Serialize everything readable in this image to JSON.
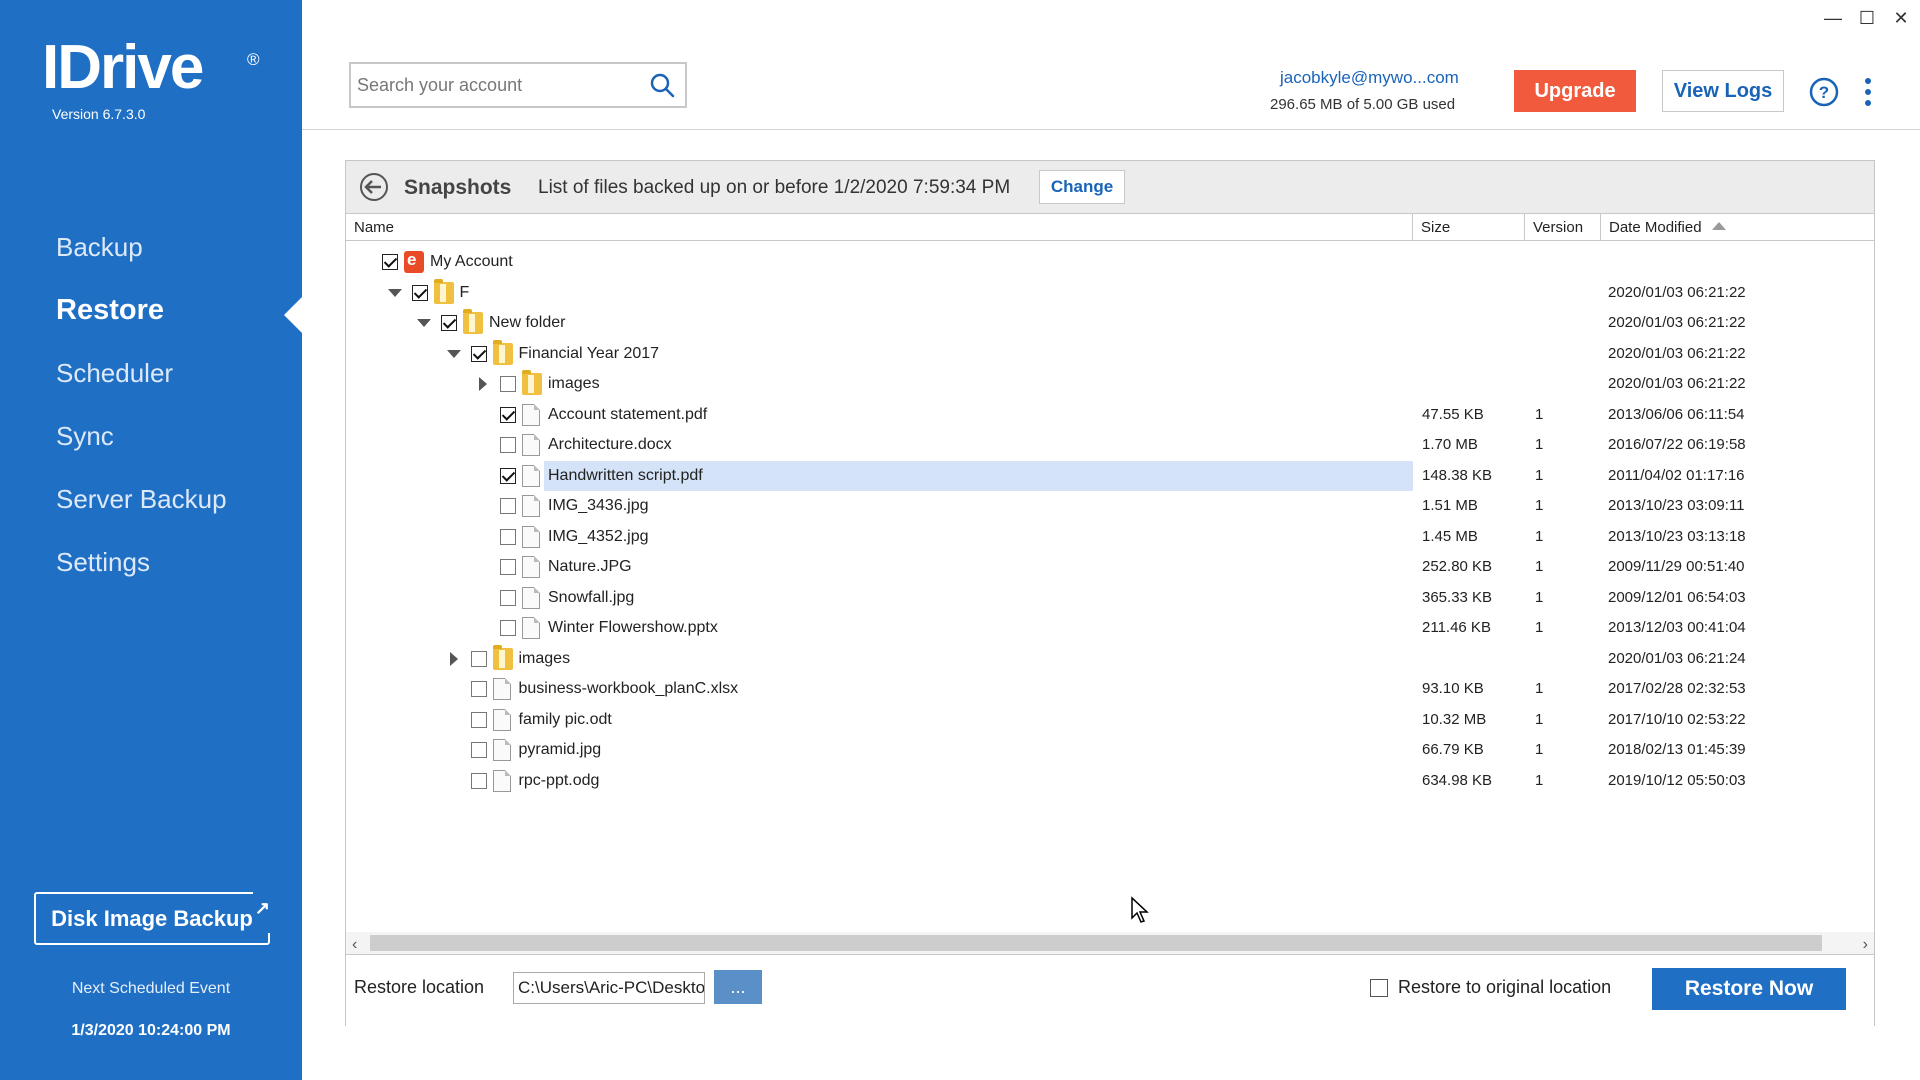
{
  "app": {
    "logo_text": "IDrive",
    "registered": "®",
    "version": "Version  6.7.3.0"
  },
  "sidebar": {
    "items": [
      {
        "label": "Backup"
      },
      {
        "label": "Restore"
      },
      {
        "label": "Scheduler"
      },
      {
        "label": "Sync"
      },
      {
        "label": "Server Backup"
      },
      {
        "label": "Settings"
      }
    ],
    "active": "Restore",
    "disk_image_label": "Disk Image Backup",
    "next_event_label": "Next Scheduled Event",
    "next_event_time": "1/3/2020 10:24:00 PM"
  },
  "window_controls": {
    "minimize": "—",
    "maximize": "☐",
    "close": "✕"
  },
  "header": {
    "search_placeholder": "Search your account",
    "email": "jacobkyle@mywo...com",
    "usage": "296.65 MB of 5.00 GB used",
    "upgrade_label": "Upgrade",
    "view_logs_label": "View Logs"
  },
  "snapshots": {
    "title": "Snapshots",
    "description": "List of files backed up on or before 1/2/2020 7:59:34 PM",
    "change_label": "Change"
  },
  "columns": {
    "name": "Name",
    "size": "Size",
    "version": "Version",
    "date": "Date Modified"
  },
  "tree": [
    {
      "name": "My Account",
      "type": "account",
      "depth": 0,
      "checked": true,
      "expand": "none",
      "size": "",
      "version": "",
      "date": ""
    },
    {
      "name": "F",
      "type": "folder",
      "depth": 1,
      "checked": true,
      "expand": "down",
      "size": "",
      "version": "",
      "date": "2020/01/03 06:21:22"
    },
    {
      "name": "New folder",
      "type": "folder",
      "depth": 2,
      "checked": true,
      "expand": "down",
      "size": "",
      "version": "",
      "date": "2020/01/03 06:21:22"
    },
    {
      "name": "Financial Year 2017",
      "type": "folder",
      "depth": 3,
      "checked": true,
      "expand": "down",
      "size": "",
      "version": "",
      "date": "2020/01/03 06:21:22"
    },
    {
      "name": "images",
      "type": "folder",
      "depth": 4,
      "checked": false,
      "expand": "right",
      "size": "",
      "version": "",
      "date": "2020/01/03 06:21:22"
    },
    {
      "name": "Account statement.pdf",
      "type": "file",
      "depth": 4,
      "checked": true,
      "expand": "none",
      "size": "47.55 KB",
      "version": "1",
      "date": "2013/06/06 06:11:54"
    },
    {
      "name": "Architecture.docx",
      "type": "file",
      "depth": 4,
      "checked": false,
      "expand": "none",
      "size": "1.70 MB",
      "version": "1",
      "date": "2016/07/22 06:19:58"
    },
    {
      "name": "Handwritten script.pdf",
      "type": "file",
      "depth": 4,
      "checked": true,
      "expand": "none",
      "selected": true,
      "size": "148.38 KB",
      "version": "1",
      "date": "2011/04/02 01:17:16"
    },
    {
      "name": "IMG_3436.jpg",
      "type": "file",
      "depth": 4,
      "checked": false,
      "expand": "none",
      "size": "1.51 MB",
      "version": "1",
      "date": "2013/10/23 03:09:11"
    },
    {
      "name": "IMG_4352.jpg",
      "type": "file",
      "depth": 4,
      "checked": false,
      "expand": "none",
      "size": "1.45 MB",
      "version": "1",
      "date": "2013/10/23 03:13:18"
    },
    {
      "name": "Nature.JPG",
      "type": "file",
      "depth": 4,
      "checked": false,
      "expand": "none",
      "size": "252.80 KB",
      "version": "1",
      "date": "2009/11/29 00:51:40"
    },
    {
      "name": "Snowfall.jpg",
      "type": "file",
      "depth": 4,
      "checked": false,
      "expand": "none",
      "size": "365.33 KB",
      "version": "1",
      "date": "2009/12/01 06:54:03"
    },
    {
      "name": "Winter Flowershow.pptx",
      "type": "file",
      "depth": 4,
      "checked": false,
      "expand": "none",
      "size": "211.46 KB",
      "version": "1",
      "date": "2013/12/03 00:41:04"
    },
    {
      "name": "images",
      "type": "folder",
      "depth": 3,
      "checked": false,
      "expand": "right",
      "size": "",
      "version": "",
      "date": "2020/01/03 06:21:24"
    },
    {
      "name": "business-workbook_planC.xlsx",
      "type": "file",
      "depth": 3,
      "checked": false,
      "expand": "none",
      "size": "93.10 KB",
      "version": "1",
      "date": "2017/02/28 02:32:53"
    },
    {
      "name": "family pic.odt",
      "type": "file",
      "depth": 3,
      "checked": false,
      "expand": "none",
      "size": "10.32 MB",
      "version": "1",
      "date": "2017/10/10 02:53:22"
    },
    {
      "name": "pyramid.jpg",
      "type": "file",
      "depth": 3,
      "checked": false,
      "expand": "none",
      "size": "66.79 KB",
      "version": "1",
      "date": "2018/02/13 01:45:39"
    },
    {
      "name": "rpc-ppt.odg",
      "type": "file",
      "depth": 3,
      "checked": false,
      "expand": "none",
      "size": "634.98 KB",
      "version": "1",
      "date": "2019/10/12 05:50:03"
    }
  ],
  "footer": {
    "restore_location_label": "Restore location",
    "restore_location_value": "C:\\Users\\Aric-PC\\Desktop",
    "browse_label": "...",
    "original_location_label": "Restore to original location",
    "original_location_checked": false,
    "restore_now_label": "Restore Now"
  },
  "colors": {
    "sidebar": "#1f6fc5",
    "upgrade": "#f15a3c",
    "accent": "#1a64b8",
    "selection": "#d4e3f7"
  }
}
